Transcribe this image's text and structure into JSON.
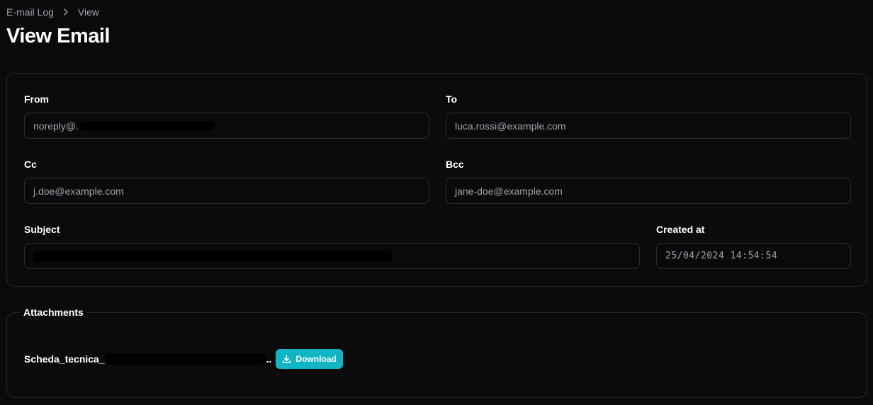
{
  "breadcrumb": {
    "items": [
      "E-mail Log",
      "View"
    ]
  },
  "page": {
    "title": "View Email"
  },
  "email": {
    "from": {
      "label": "From",
      "value": "noreply@."
    },
    "to": {
      "label": "To",
      "value": "luca.rossi@example.com"
    },
    "cc": {
      "label": "Cc",
      "value": "j.doe@example.com"
    },
    "bcc": {
      "label": "Bcc",
      "value": "jane-doe@example.com"
    },
    "subject": {
      "label": "Subject",
      "value": ""
    },
    "created_at": {
      "label": "Created at",
      "value": "25/04/2024 14:54:54"
    }
  },
  "attachments": {
    "legend": "Attachments",
    "items": [
      {
        "name": "Scheda_tecnica_",
        "suffix": "..",
        "download_label": "Download"
      }
    ]
  },
  "colors": {
    "background": "#0a0a0c",
    "accent": "#0fb5c2",
    "border": "#27272a"
  }
}
